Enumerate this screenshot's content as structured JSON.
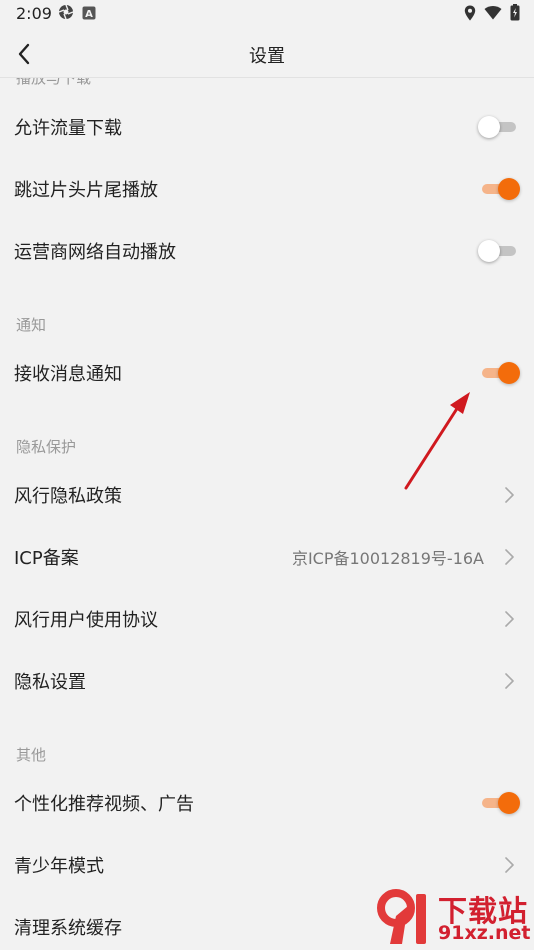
{
  "status_bar": {
    "time": "2:09"
  },
  "header": {
    "title": "设置"
  },
  "clipped_section_header": "播放与下载",
  "rows": {
    "allow_data_download": {
      "label": "允许流量下载",
      "toggle": "off"
    },
    "skip_intro_outro": {
      "label": "跳过片头片尾播放",
      "toggle": "on"
    },
    "carrier_autoplay": {
      "label": "运营商网络自动播放",
      "toggle": "off"
    },
    "receive_notifications": {
      "label": "接收消息通知",
      "toggle": "on"
    },
    "privacy_policy": {
      "label": "风行隐私政策"
    },
    "icp_filing": {
      "label": "ICP备案",
      "value": "京ICP备10012819号-16A"
    },
    "user_agreement": {
      "label": "风行用户使用协议"
    },
    "privacy_settings": {
      "label": "隐私设置"
    },
    "personalized_recs": {
      "label": "个性化推荐视频、广告",
      "toggle": "on"
    },
    "youth_mode": {
      "label": "青少年模式"
    },
    "clear_cache": {
      "label": "清理系统缓存"
    }
  },
  "sections": {
    "notifications": "通知",
    "privacy": "隐私保护",
    "other": "其他"
  },
  "watermark": {
    "top": "下载站",
    "bottom": "91xz.net",
    "logo": "91"
  },
  "colors": {
    "accent": "#f36c0b",
    "accent_track": "#f5b48a",
    "arrow": "#d0191f"
  }
}
